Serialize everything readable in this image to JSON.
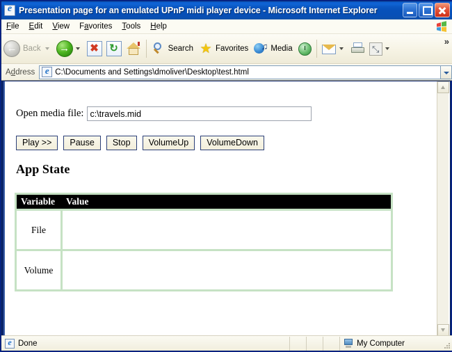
{
  "window": {
    "title": "Presentation page for an emulated UPnP midi player device - Microsoft Internet Explorer",
    "icon": "ie-page-icon",
    "controls": {
      "minimize": "minimize-button",
      "maximize": "maximize-button",
      "close": "close-button"
    }
  },
  "menu": {
    "items": [
      {
        "label": "File",
        "accel": "F"
      },
      {
        "label": "Edit",
        "accel": "E"
      },
      {
        "label": "View",
        "accel": "V"
      },
      {
        "label": "Favorites",
        "accel": "a"
      },
      {
        "label": "Tools",
        "accel": "T"
      },
      {
        "label": "Help",
        "accel": "H"
      }
    ],
    "brand_icon": "windows-flag-icon"
  },
  "toolbar": {
    "back_label": "Back",
    "items": [
      {
        "name": "back-button",
        "icon": "arrow-left-icon",
        "label": "Back",
        "enabled": false
      },
      {
        "name": "forward-button",
        "icon": "arrow-right-icon",
        "label": "",
        "enabled": true
      },
      {
        "name": "stop-button",
        "icon": "stop-x-icon",
        "label": "",
        "enabled": true
      },
      {
        "name": "refresh-button",
        "icon": "refresh-icon",
        "label": "",
        "enabled": true
      },
      {
        "name": "home-button",
        "icon": "home-icon",
        "label": "",
        "enabled": true
      },
      {
        "name": "search-button",
        "icon": "search-icon",
        "label": "Search",
        "enabled": true
      },
      {
        "name": "favorites-button",
        "icon": "star-icon",
        "label": "Favorites",
        "enabled": true
      },
      {
        "name": "media-button",
        "icon": "media-globe-icon",
        "label": "Media",
        "enabled": true
      },
      {
        "name": "history-button",
        "icon": "history-clock-icon",
        "label": "",
        "enabled": true
      },
      {
        "name": "mail-button",
        "icon": "mail-envelope-icon",
        "label": "",
        "enabled": true
      },
      {
        "name": "print-button",
        "icon": "printer-icon",
        "label": "",
        "enabled": true
      },
      {
        "name": "edit-button",
        "icon": "fullscreen-icon",
        "label": "",
        "enabled": true
      }
    ],
    "search_label": "Search",
    "favorites_label": "Favorites",
    "media_label": "Media",
    "overflow_glyph": "»"
  },
  "address_bar": {
    "label": "Address",
    "icon": "ie-page-icon",
    "url": "C:\\Documents and Settings\\dmoliver\\Desktop\\test.html",
    "dropdown_icon": "chevron-down-icon"
  },
  "page": {
    "form": {
      "label": "Open media file:",
      "input_value": "c:\\travels.mid",
      "input_placeholder": ""
    },
    "buttons": [
      {
        "label": "Play >>",
        "name": "play-button"
      },
      {
        "label": "Pause",
        "name": "pause-button"
      },
      {
        "label": "Stop",
        "name": "stop-button"
      },
      {
        "label": "VolumeUp",
        "name": "volume-up-button"
      },
      {
        "label": "VolumeDown",
        "name": "volume-down-button"
      }
    ],
    "heading": "App State",
    "table": {
      "headers": [
        "Variable",
        "Value"
      ],
      "rows": [
        {
          "variable": "File",
          "value": ""
        },
        {
          "variable": "Volume",
          "value": ""
        }
      ],
      "border_color": "#C6E2C4",
      "header_bg": "#000000"
    }
  },
  "scrollbar": {
    "up_icon": "chevron-up-icon",
    "down_icon": "chevron-down-icon"
  },
  "status_bar": {
    "message": "Done",
    "message_icon": "ie-page-icon",
    "zone": "My Computer",
    "zone_icon": "my-computer-icon"
  }
}
